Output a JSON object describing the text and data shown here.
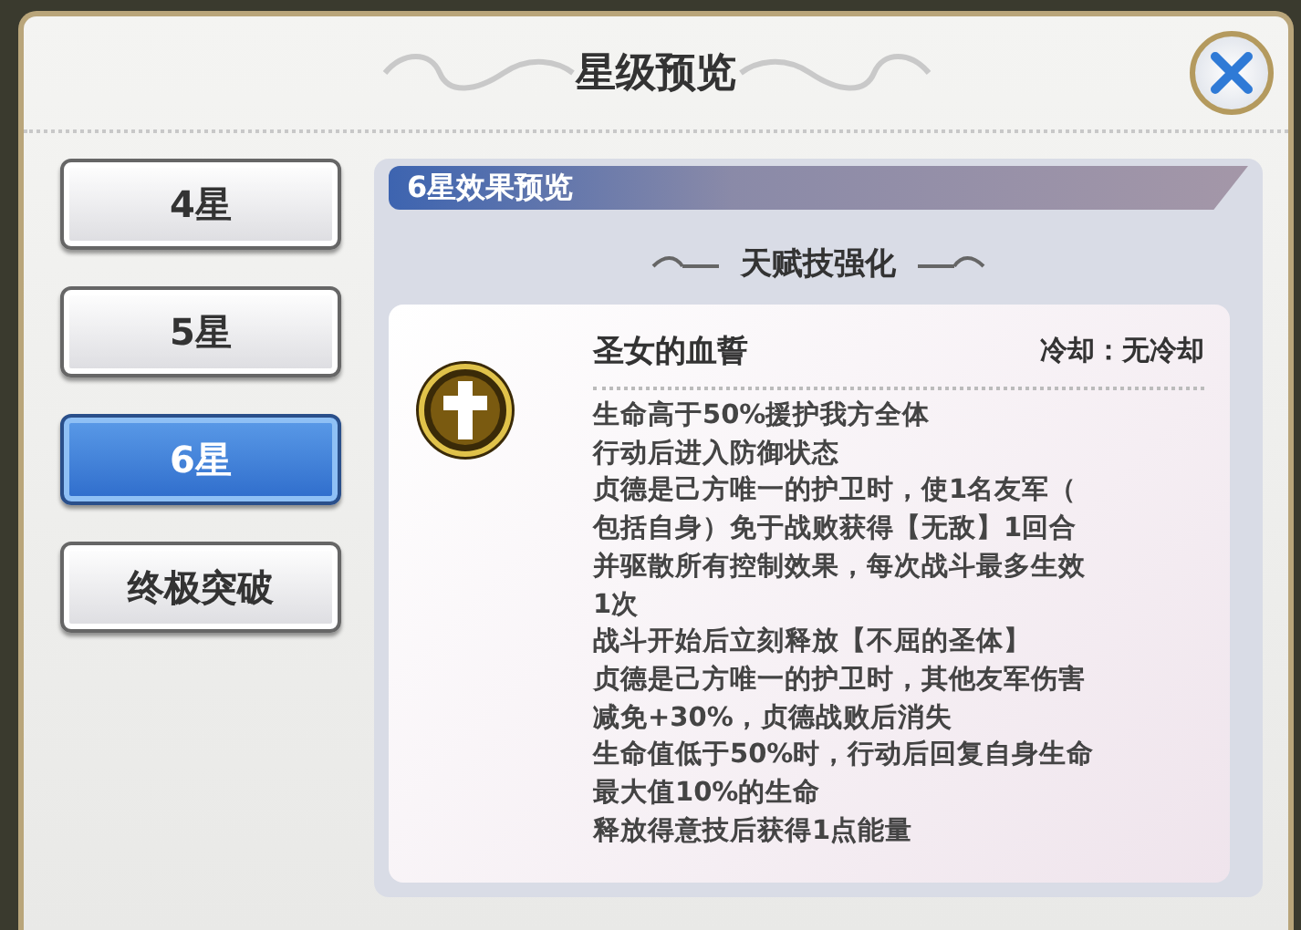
{
  "window": {
    "title": "星级预览"
  },
  "tabs": [
    {
      "label": "4星",
      "selected": false
    },
    {
      "label": "5星",
      "selected": false
    },
    {
      "label": "6星",
      "selected": true
    },
    {
      "label": "终极突破",
      "selected": false
    }
  ],
  "panel": {
    "header": "6星效果预览",
    "section_title": "天赋技强化",
    "skill": {
      "name": "圣女的血誓",
      "cooldown": "冷却：无冷却",
      "description_lines": [
        "生命高于50%援护我方全体",
        "行动后进入防御状态",
        "贞德是己方唯一的护卫时，使1名友军（",
        "包括自身）免于战败获得【无敌】1回合",
        "并驱散所有控制效果，每次战斗最多生效",
        "1次",
        "战斗开始后立刻释放【不屈的圣体】",
        "贞德是己方唯一的护卫时，其他友军伤害",
        "减免+30%，贞德战败后消失",
        "生命值低于50%时，行动后回复自身生命",
        "最大值10%的生命",
        "释放得意技后获得1点能量"
      ]
    }
  }
}
